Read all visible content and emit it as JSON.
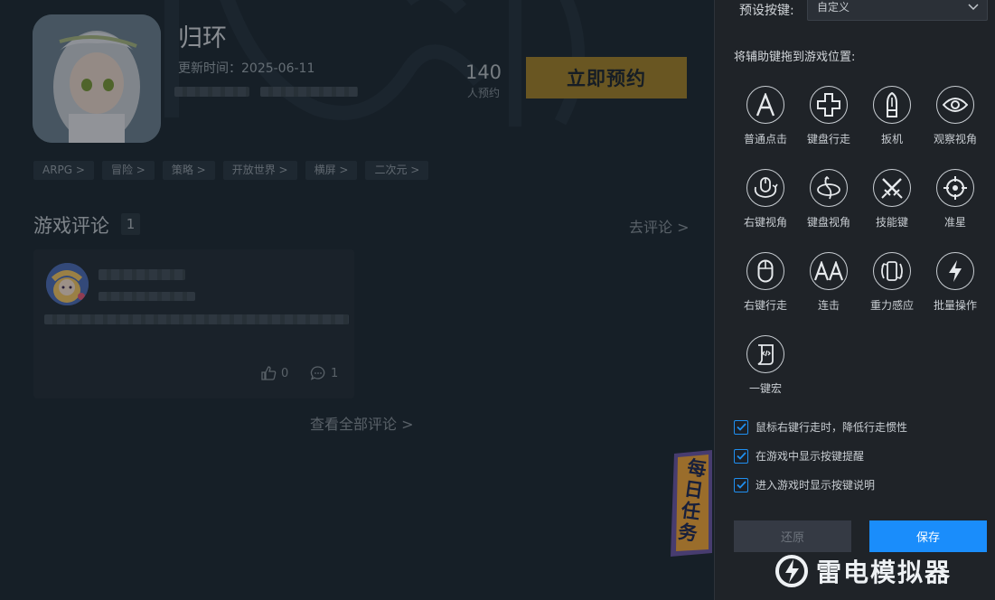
{
  "game": {
    "title": "归环",
    "update_label": "更新时间：",
    "update_date": "2025-06-11",
    "reserve_count": "140",
    "reserve_count_label": "人预约",
    "reserve_button": "立即预约",
    "tags": [
      "ARPG >",
      "冒险 >",
      "策略 >",
      "开放世界 >",
      "横屏 >",
      "二次元 >"
    ]
  },
  "comments": {
    "title": "游戏评论",
    "count": "1",
    "go_comment": "去评论 >",
    "like_count": "0",
    "reply_count": "1",
    "see_all": "查看全部评论 >"
  },
  "daily_task": "每日任务",
  "panel": {
    "preset_label": "预设按键:",
    "preset_value": "自定义",
    "drag_hint": "将辅助键拖到游戏位置:",
    "tools": [
      {
        "label": "普通点击",
        "icon": "letter-a-icon"
      },
      {
        "label": "键盘行走",
        "icon": "dpad-icon"
      },
      {
        "label": "扳机",
        "icon": "bullet-icon"
      },
      {
        "label": "观察视角",
        "icon": "eye-icon"
      },
      {
        "label": "右键视角",
        "icon": "mouse-rotate-icon"
      },
      {
        "label": "键盘视角",
        "icon": "keyboard-rotate-icon"
      },
      {
        "label": "技能键",
        "icon": "crossed-swords-icon"
      },
      {
        "label": "准星",
        "icon": "crosshair-icon"
      },
      {
        "label": "右键行走",
        "icon": "mouse-icon"
      },
      {
        "label": "连击",
        "icon": "double-a-icon"
      },
      {
        "label": "重力感应",
        "icon": "phone-rotate-icon"
      },
      {
        "label": "批量操作",
        "icon": "lightning-icon"
      },
      {
        "label": "一键宏",
        "icon": "script-icon"
      }
    ],
    "options": [
      {
        "label": "鼠标右键行走时，降低行走惯性",
        "checked": true
      },
      {
        "label": "在游戏中显示按键提醒",
        "checked": true
      },
      {
        "label": "进入游戏时显示按键说明",
        "checked": true
      }
    ],
    "restore_button": "还原",
    "save_button": "保存",
    "brand": "雷电模拟器"
  },
  "colors": {
    "accent_blue": "#1a8dfb",
    "reserve_gold": "#a3842c",
    "panel_bg": "#1f2328"
  }
}
